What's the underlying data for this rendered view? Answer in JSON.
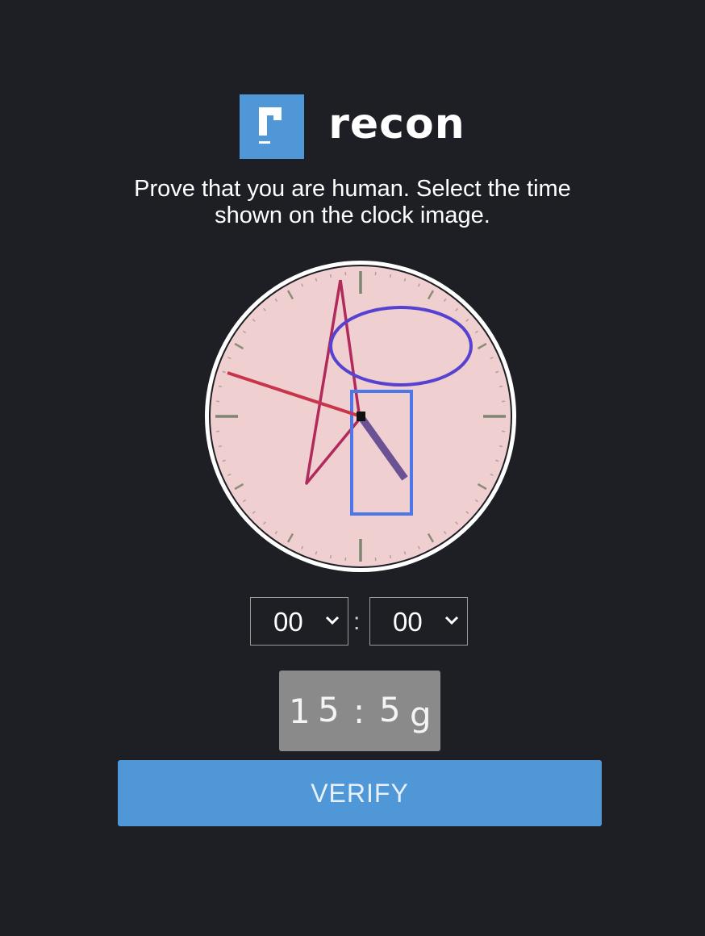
{
  "brand": {
    "logo_letter": "r",
    "name": "recon",
    "color": "#4f97d6"
  },
  "instructions": {
    "line1": "Prove that you are human. Select the time",
    "line2": "shown on the clock image."
  },
  "clock": {
    "face_color": "#f0cfd1",
    "hour_hand_color": "#6a5295",
    "minute_hand_color": "#c8354a",
    "scribble_triangle_color": "#b02a5c",
    "scribble_ellipse_color": "#5542d0",
    "scribble_rect_color": "#4d77e8"
  },
  "time_select": {
    "hours_value": "00",
    "separator": ":",
    "minutes_value": "00",
    "chevron_icon": "chevron-down-icon"
  },
  "captcha": {
    "chars": [
      "1",
      "5",
      ":",
      "5",
      "g"
    ]
  },
  "verify_button": {
    "label": "VERIFY",
    "color": "#4f97d6"
  }
}
